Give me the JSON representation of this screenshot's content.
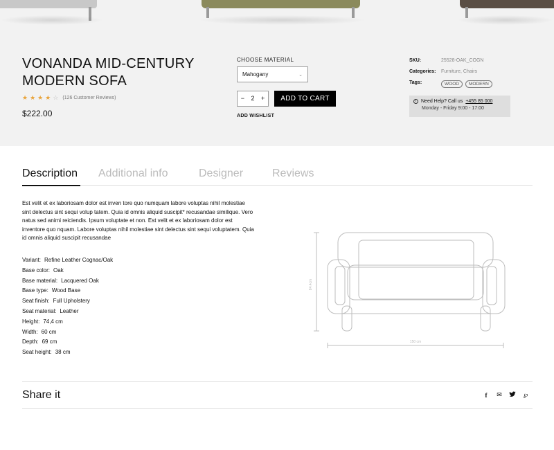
{
  "product": {
    "title": "VONANDA MID-CENTURY MODERN SOFA",
    "stars_filled": 4,
    "stars_total": 5,
    "reviews": "(126 Customer Reviews)",
    "price": "$222.00"
  },
  "purchase": {
    "material_label": "CHOOSE MATERIAL",
    "material_value": "Mahogany",
    "qty_minus": "−",
    "qty_value": "2",
    "qty_plus": "+",
    "add_to_cart": "ADD TO CART",
    "add_wishlist": "ADD WISHLIST"
  },
  "meta": {
    "sku_label": "SKU:",
    "sku_value": "25528-OAK_COGN",
    "categories_label": "Categories:",
    "categories_value": "Furniture, Chairs",
    "tags_label": "Tags:",
    "tags": [
      "WOOD",
      "MODERN"
    ]
  },
  "help": {
    "prefix": "Need Help? Call us",
    "phone": "+455 85 000",
    "hours": "Monday - Friday 9:00 - 17:00"
  },
  "tabs": [
    "Description",
    "Additional info",
    "Designer",
    "Reviews"
  ],
  "description": "Est velit et ex laboriosam dolor est inven tore quo numquam labore voluptas nihil molestiae sint delectus sint sequi volup tatem. Quia id omnis aliquid suscipit* recusandae similique. Vero natus sed animi reiciendis. Ipsum voluptate et non. Est velit et ex laboriosam dolor est inventore quo nquam. Labore voluptas nihil molestiae sint delectus sint sequi voluptatem. Quia id omnis aliquid suscipit recusandae",
  "specs": [
    {
      "key": "Variant:",
      "value": "Refine Leather Cognac/Oak"
    },
    {
      "key": "Base color:",
      "value": "Oak"
    },
    {
      "key": "Base material:",
      "value": "Lacquered Oak"
    },
    {
      "key": "Base type:",
      "value": "Wood Base"
    },
    {
      "key": "Seat finish:",
      "value": "Full Upholstery"
    },
    {
      "key": "Seat material:",
      "value": "Leather"
    },
    {
      "key": "Height:",
      "value": "74,4 cm"
    },
    {
      "key": "Width:",
      "value": "60 cm"
    },
    {
      "key": "Depth:",
      "value": "69 cm"
    },
    {
      "key": "Seat height:",
      "value": "38 cm"
    }
  ],
  "drawing": {
    "height_label": "84.4cm",
    "width_label": "150 cm"
  },
  "share": {
    "title": "Share it",
    "icons": [
      "facebook-icon",
      "mail-icon",
      "twitter-icon",
      "pinterest-icon"
    ]
  },
  "colors": {
    "band": "#f2f2f2",
    "star": "#e9a43c",
    "button": "#000000"
  }
}
